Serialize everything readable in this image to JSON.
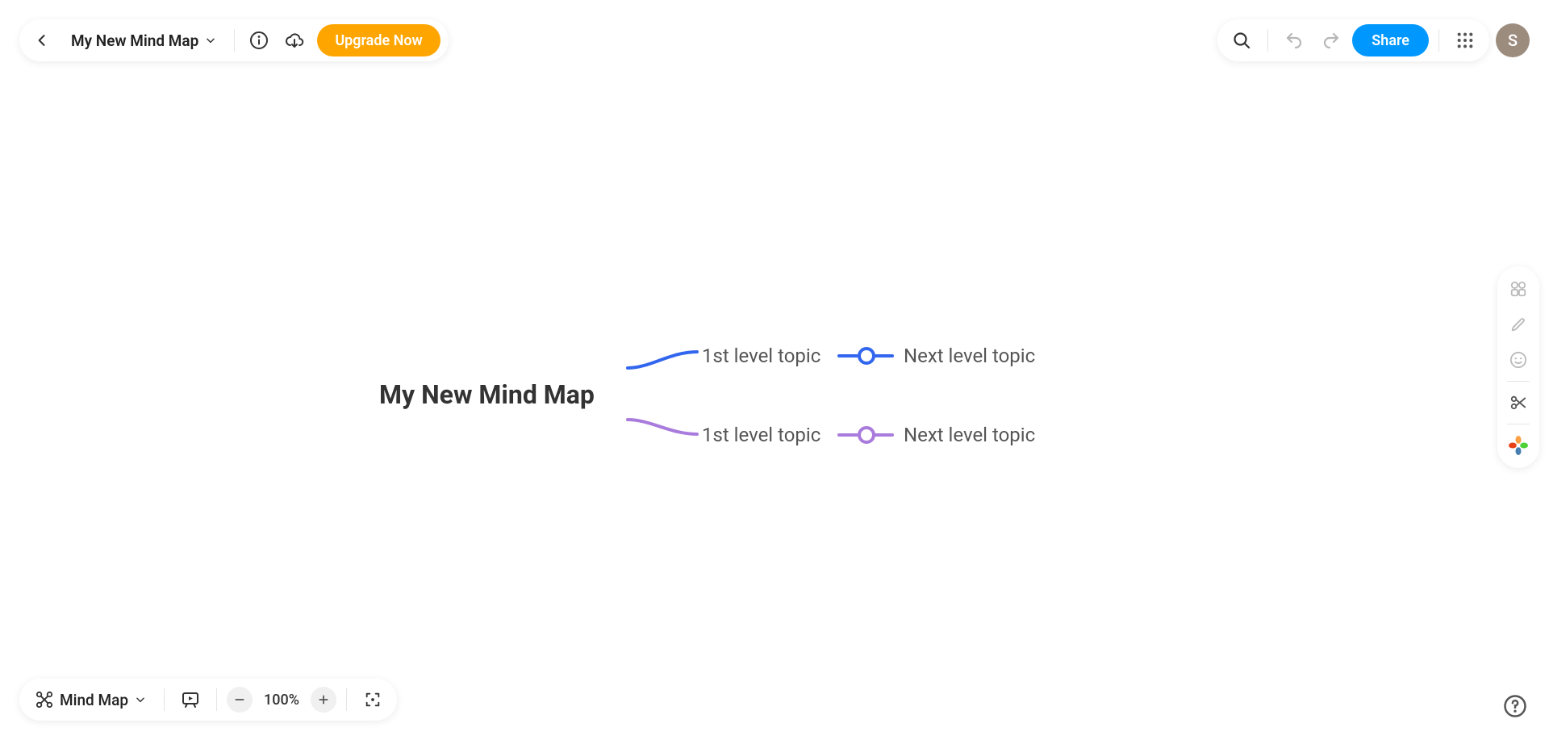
{
  "header": {
    "title": "My New Mind Map",
    "upgrade_label": "Upgrade Now",
    "share_label": "Share",
    "avatar_initial": "S"
  },
  "mindmap": {
    "root": "My New Mind Map",
    "branches": [
      {
        "label": "1st level topic",
        "color": "#3366ee",
        "child": "Next level topic"
      },
      {
        "label": "1st level topic",
        "color": "#a97bdc",
        "child": "Next level topic"
      }
    ]
  },
  "footer": {
    "view_mode": "Mind Map",
    "zoom": "100%"
  }
}
